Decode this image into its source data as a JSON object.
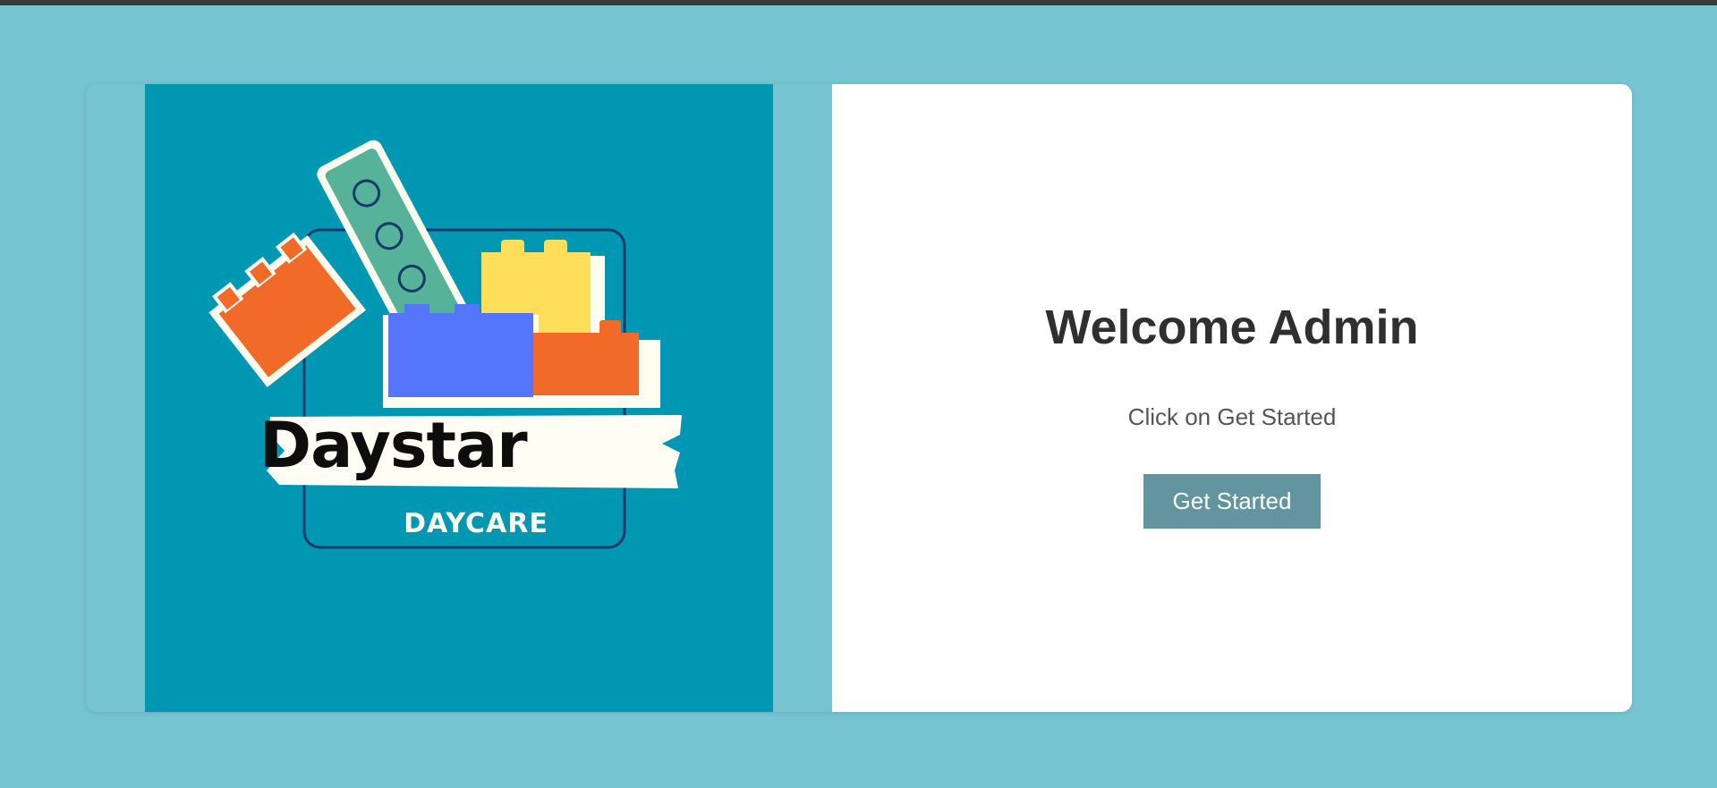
{
  "logo": {
    "brand_name": "Daystar",
    "brand_tagline": "DAYCARE"
  },
  "welcome": {
    "title": "Welcome Admin",
    "subtitle": "Click on Get Started",
    "button_label": "Get Started"
  },
  "colors": {
    "page_background": "#76c3d2",
    "logo_background": "#0097b3",
    "button_background": "#62959f",
    "title_text": "#2f2f2f"
  }
}
